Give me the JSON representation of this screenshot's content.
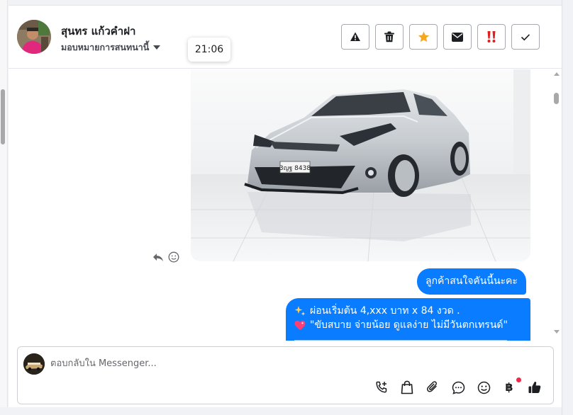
{
  "contact": {
    "name": "สุนทร แก้วคำฝา",
    "assign_label": "มอบหมายการสนทนานี้"
  },
  "tooltip": {
    "time": "21:06"
  },
  "header_actions": [
    {
      "name": "report-spam-button",
      "icon": "warning-triangle-icon"
    },
    {
      "name": "delete-button",
      "icon": "trash-icon"
    },
    {
      "name": "star-button",
      "icon": "star-icon",
      "color": "#f5a623"
    },
    {
      "name": "mark-unread-button",
      "icon": "envelope-icon"
    },
    {
      "name": "follow-up-button",
      "icon": "double-exclamation-icon",
      "color": "#e02020"
    },
    {
      "name": "mark-done-button",
      "icon": "checkmark-icon"
    }
  ],
  "messages": [
    {
      "type": "image",
      "alt": "silver sedan in showroom",
      "plate": "3ญฐ 8438"
    },
    {
      "type": "text",
      "from": "page",
      "text": "ลูกค้าสนใจคันนี้นะคะ"
    },
    {
      "type": "text",
      "from": "page",
      "lines": [
        {
          "icon": "sparkles-icon",
          "text": "ผ่อนเริ่มต้น 4,xxx บาท x 84 งวด ."
        },
        {
          "icon": "sparkling-heart-icon",
          "text": "\"ขับสบาย จ่ายน้อย ดูแลง่าย ไม่มีวันตกเทรนด์\""
        }
      ]
    }
  ],
  "composer": {
    "placeholder": "ตอบกลับใน Messenger..."
  },
  "composer_tools": [
    "add-call-icon",
    "shopping-bag-icon",
    "paperclip-icon",
    "chat-bubble-icon",
    "emoji-icon",
    "baht-icon",
    "thumbs-up-icon"
  ],
  "colors": {
    "accent": "#0a7cff",
    "star": "#f5a623",
    "urgent": "#e02020",
    "notification_dot": "#f02849"
  }
}
